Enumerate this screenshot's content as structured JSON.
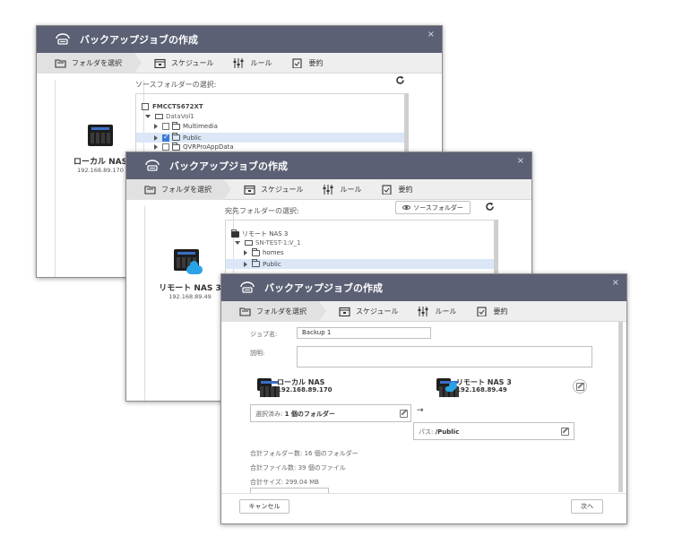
{
  "title": "バックアップジョブの作成",
  "close_glyph": "×",
  "steps": {
    "folder": "フォルダを選択",
    "schedule": "スケジュール",
    "rule": "ルール",
    "summary": "要約"
  },
  "dialog1": {
    "section_label": "ソースフォルダーの選択:",
    "nas_name": "ローカル NAS",
    "nas_ip": "192.168.89.170",
    "tree": {
      "root": "FMCCTS672XT",
      "volume": "DataVol1",
      "items": [
        "Multimedia",
        "Public",
        "QVRProAppData"
      ]
    }
  },
  "dialog2": {
    "section_label": "宛先フォルダーの選択:",
    "source_button": "ソースフォルダー",
    "nas_name": "リモート NAS 3",
    "nas_ip": "192.168.89.49",
    "tree": {
      "root": "リモート NAS 3",
      "volume": "SN-TEST-1:V_1",
      "items": [
        "homes",
        "Public"
      ]
    }
  },
  "dialog3": {
    "job_name_label": "ジョブ名:",
    "job_name_value": "Backup 1",
    "description_label": "説明:",
    "local_nas_name": "ローカル NAS",
    "local_nas_ip": "192.168.89.170",
    "remote_nas_name": "リモート NAS 3",
    "remote_nas_ip": "192.168.89.49",
    "selected_label": "選択済み:",
    "selected_value": "1 個のフォルダー",
    "arrow": "→",
    "path_label": "パス:",
    "path_value": "/Public",
    "total_folders": "合計フォルダー数: 16 個のフォルダー",
    "total_files": "合計ファイル数: 39 個のファイル",
    "total_size": "合計サイズ: 299.04 MB",
    "cancel_button": "キャンセル",
    "next_button": "次へ"
  }
}
